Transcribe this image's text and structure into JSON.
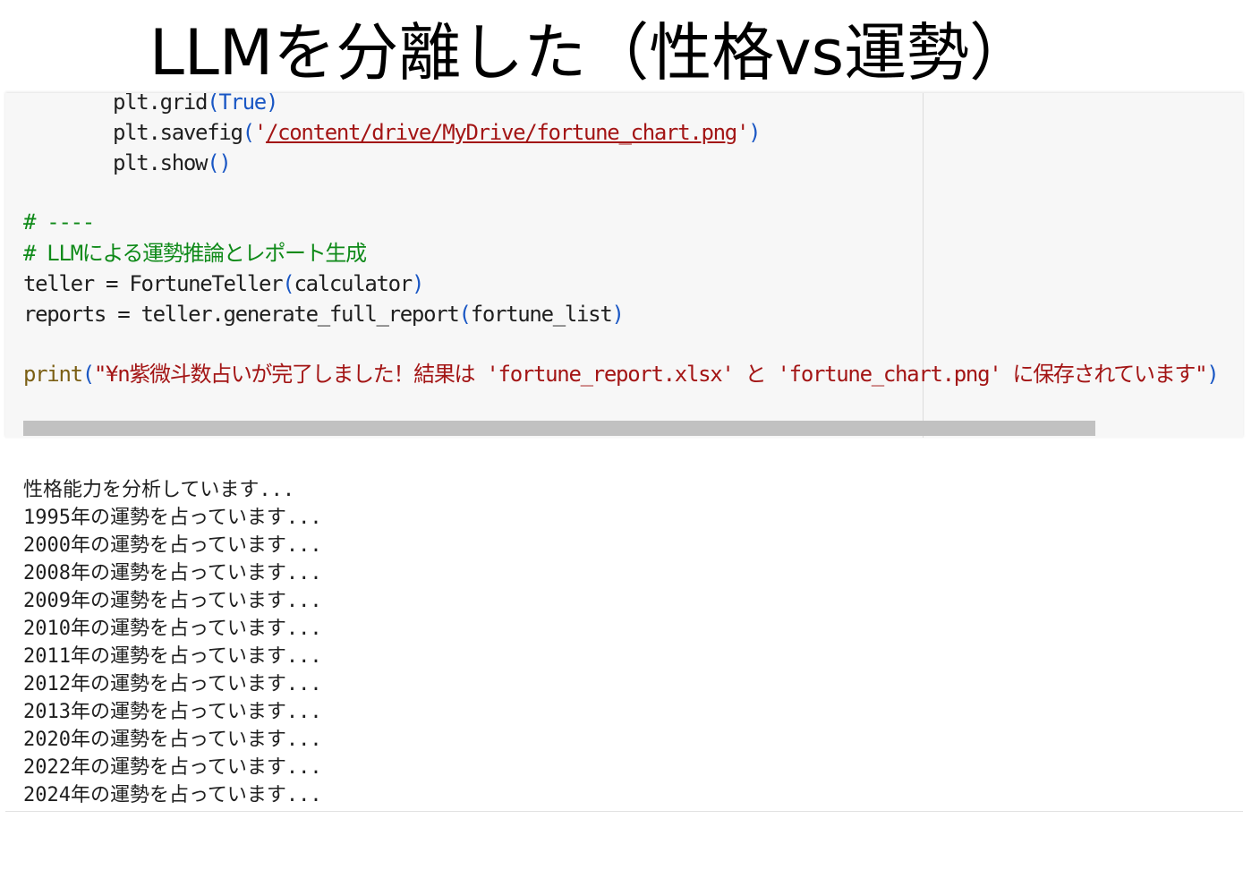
{
  "title": "LLMを分離した（性格vs運勢）",
  "code": {
    "line1": {
      "obj": "plt.grid",
      "open": "(",
      "arg": "True",
      "close": ")"
    },
    "line2": {
      "obj": "plt.savefig",
      "open": "(",
      "q1": "'",
      "path": "/content/drive/MyDrive/fortune_chart.png",
      "q2": "'",
      "close": ")"
    },
    "line3": {
      "obj": "plt.show",
      "parens": "()"
    },
    "comment1": "# ----",
    "comment2": "# LLMによる運勢推論とレポート生成",
    "line4": {
      "pre": "teller = FortuneTeller",
      "open": "(",
      "arg": "calculator",
      "close": ")"
    },
    "line5": {
      "pre": "reports = teller.generate_full_report",
      "open": "(",
      "arg": "fortune_list",
      "close": ")"
    },
    "line6": {
      "fn": "print",
      "open": "(",
      "str": "\"¥n紫微斗数占いが完了しました！結果は 'fortune_report.xlsx' と 'fortune_chart.png' に保存されています\"",
      "close": ")"
    }
  },
  "output": {
    "lines": [
      "性格能力を分析しています...",
      "1995年の運勢を占っています...",
      "2000年の運勢を占っています...",
      "2008年の運勢を占っています...",
      "2009年の運勢を占っています...",
      "2010年の運勢を占っています...",
      "2011年の運勢を占っています...",
      "2012年の運勢を占っています...",
      "2013年の運勢を占っています...",
      "2020年の運勢を占っています...",
      "2022年の運勢を占っています...",
      "2024年の運勢を占っています..."
    ]
  }
}
